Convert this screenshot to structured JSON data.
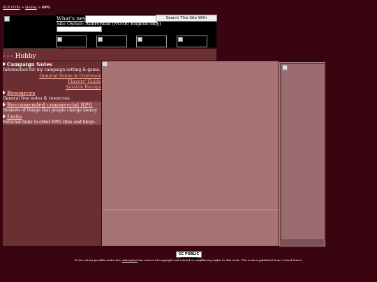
{
  "breadcrumb": {
    "site": "ELP GVM",
    "sep1": ">",
    "section": "Hobby",
    "sep2": ">",
    "current": "RPG"
  },
  "header": {
    "whats_new": "What's new?",
    "search_value": "",
    "search_button": "Search This Site With Prosearch",
    "owner_text": "Site Owner: Aubreykun (NOTE: English only)"
  },
  "title": "- - - Hobby",
  "sidebar": {
    "sections": [
      {
        "heading": "Campaign Notes",
        "linked": false,
        "description": "Information for my campaign setting & game.",
        "links": [
          "General Notes & Overview",
          "Players' Guide",
          "Session Recaps"
        ]
      },
      {
        "heading": "Resources",
        "linked": true,
        "description": "General free notes & resources.",
        "links": []
      },
      {
        "heading": "Reccomended commercial RPG products.",
        "linked": true,
        "description": "Reviews of things that people charge money for.",
        "links": []
      },
      {
        "heading": "Links",
        "linked": true,
        "description": "External links to other RPG sites and blogs.",
        "links": []
      }
    ]
  },
  "footer": {
    "badge": "CC PUBLIC DOMAIN",
    "text_before": "To the extent possible under law,",
    "owner_link": "Aubreykun",
    "text_after": "has waived all copyright and related or neighboring rights to this work. This work is published from: United States."
  },
  "colors": {
    "background": "#3a0510",
    "panel": "#6b2f33",
    "center": "#a87373",
    "link": "#ffb0a0"
  }
}
